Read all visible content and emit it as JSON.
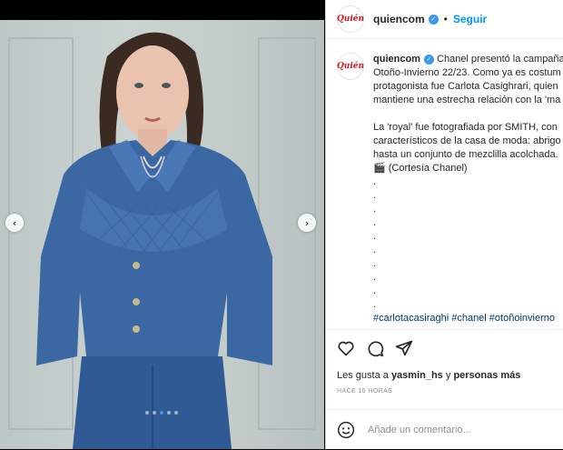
{
  "account": {
    "username": "quiencom",
    "logo_text": "Quién",
    "verified_mark": "✓",
    "separator": "•",
    "follow_label": "Seguir"
  },
  "caption": {
    "username": "quiencom",
    "lines": [
      "Chanel presentó la campaña",
      "Otoño-Invierno 22/23. Como ya es costum",
      "protagonista fue Carlota Casighrari, quien",
      "mantiene una estrecha relación con la 'ma",
      "",
      "La 'royal' fue fotografiada por SMITH, con",
      "característicos de la casa de moda: abrigo",
      "hasta un conjunto de mezclilla acolchada.",
      "🎬 (Cortesía Chanel)",
      ".",
      ".",
      ".",
      ".",
      ".",
      ".",
      ".",
      ".",
      ".",
      "."
    ],
    "hashtags": "#carlotacasiraghi #chanel #otoñoinvierno"
  },
  "actions": {
    "like_icon": "heart-icon",
    "comment_icon": "comment-icon",
    "share_icon": "share-icon"
  },
  "likes": {
    "prefix": "Les gusta a",
    "user": "yasmin_hs",
    "connector": "y",
    "others": "personas más"
  },
  "timestamp": "HACE 10 HORAS",
  "comment": {
    "placeholder": "Añade un comentario..."
  },
  "carousel": {
    "prev": "‹",
    "next": "›",
    "slide_count": 5,
    "active_slide": 3,
    "accent": "#3897f0"
  }
}
